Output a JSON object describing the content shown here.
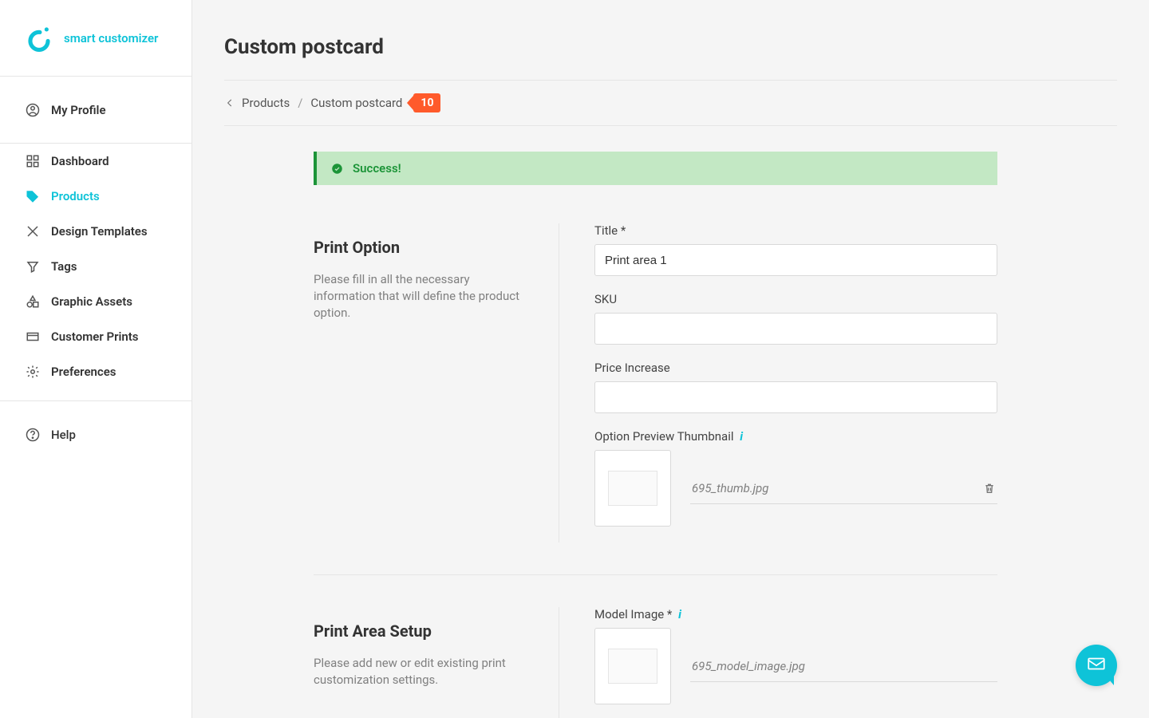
{
  "brand": {
    "name": "smart customizer"
  },
  "sidebar": {
    "profile": "My Profile",
    "items": [
      {
        "label": "Dashboard"
      },
      {
        "label": "Products"
      },
      {
        "label": "Design Templates"
      },
      {
        "label": "Tags"
      },
      {
        "label": "Graphic Assets"
      },
      {
        "label": "Customer Prints"
      },
      {
        "label": "Preferences"
      }
    ],
    "help": "Help"
  },
  "page": {
    "title": "Custom postcard"
  },
  "breadcrumbs": {
    "root": "Products",
    "current": "Custom postcard",
    "badge": "10"
  },
  "alert": {
    "text": "Success!"
  },
  "print_option": {
    "heading": "Print Option",
    "description": "Please fill in all the necessary information that will define the product option.",
    "title_label": "Title *",
    "title_value": "Print area 1",
    "sku_label": "SKU",
    "sku_value": "",
    "price_label": "Price Increase",
    "price_value": "",
    "thumb_label": "Option Preview Thumbnail",
    "thumb_file": "695_thumb.jpg"
  },
  "print_area": {
    "heading": "Print Area Setup",
    "description": "Please add new or edit existing print customization settings.",
    "model_label": "Model Image *",
    "model_file": "695_model_image.jpg"
  }
}
